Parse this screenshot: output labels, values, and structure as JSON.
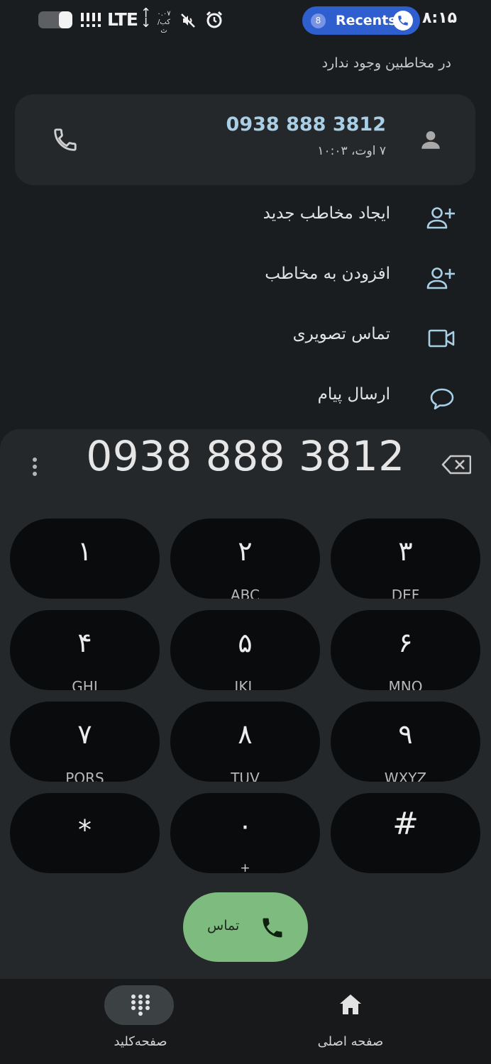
{
  "status_bar": {
    "network": "LTE",
    "net_speed_value": "۰.۰۷",
    "net_speed_unit": "کب/ث",
    "recents_count": "8",
    "recents_label": "Recents",
    "time": "۸:۱۵",
    "battery_level": 0.4
  },
  "search": {
    "no_contacts_text": "در مخاطبین وجود ندارد"
  },
  "result": {
    "number": "0938 888 3812",
    "date": "۷ اوت، ۱۰:۰۳"
  },
  "actions": [
    {
      "label": "ایجاد مخاطب جدید",
      "icon": "person-add-icon"
    },
    {
      "label": "افزودن به مخاطب",
      "icon": "person-add-icon"
    },
    {
      "label": "تماس تصویری",
      "icon": "video-camera-icon"
    },
    {
      "label": "ارسال پیام",
      "icon": "message-bubble-icon"
    }
  ],
  "dialer": {
    "entered_number": "0938 888 3812",
    "keys": [
      {
        "digit": "۱",
        "letters": "ــ"
      },
      {
        "digit": "۲",
        "letters": "ABC"
      },
      {
        "digit": "۳",
        "letters": "DEF"
      },
      {
        "digit": "۴",
        "letters": "GHI"
      },
      {
        "digit": "۵",
        "letters": "JKL"
      },
      {
        "digit": "۶",
        "letters": "MNO"
      },
      {
        "digit": "۷",
        "letters": "PQRS"
      },
      {
        "digit": "۸",
        "letters": "TUV"
      },
      {
        "digit": "۹",
        "letters": "WXYZ"
      },
      {
        "digit": "*",
        "letters": ""
      },
      {
        "digit": "۰",
        "letters": "+"
      },
      {
        "digit": "#",
        "letters": ""
      }
    ],
    "call_label": "تماس"
  },
  "bottom_nav": {
    "keypad_label": "صفحه‌کلید",
    "home_label": "صفحه اصلی"
  },
  "colors": {
    "background": "#1a1d20",
    "card": "#25282b",
    "key": "#090b0c",
    "call_green": "#7dbb7e",
    "recents_blue": "#2f5fcf",
    "number_blue": "#a9cfe6"
  }
}
